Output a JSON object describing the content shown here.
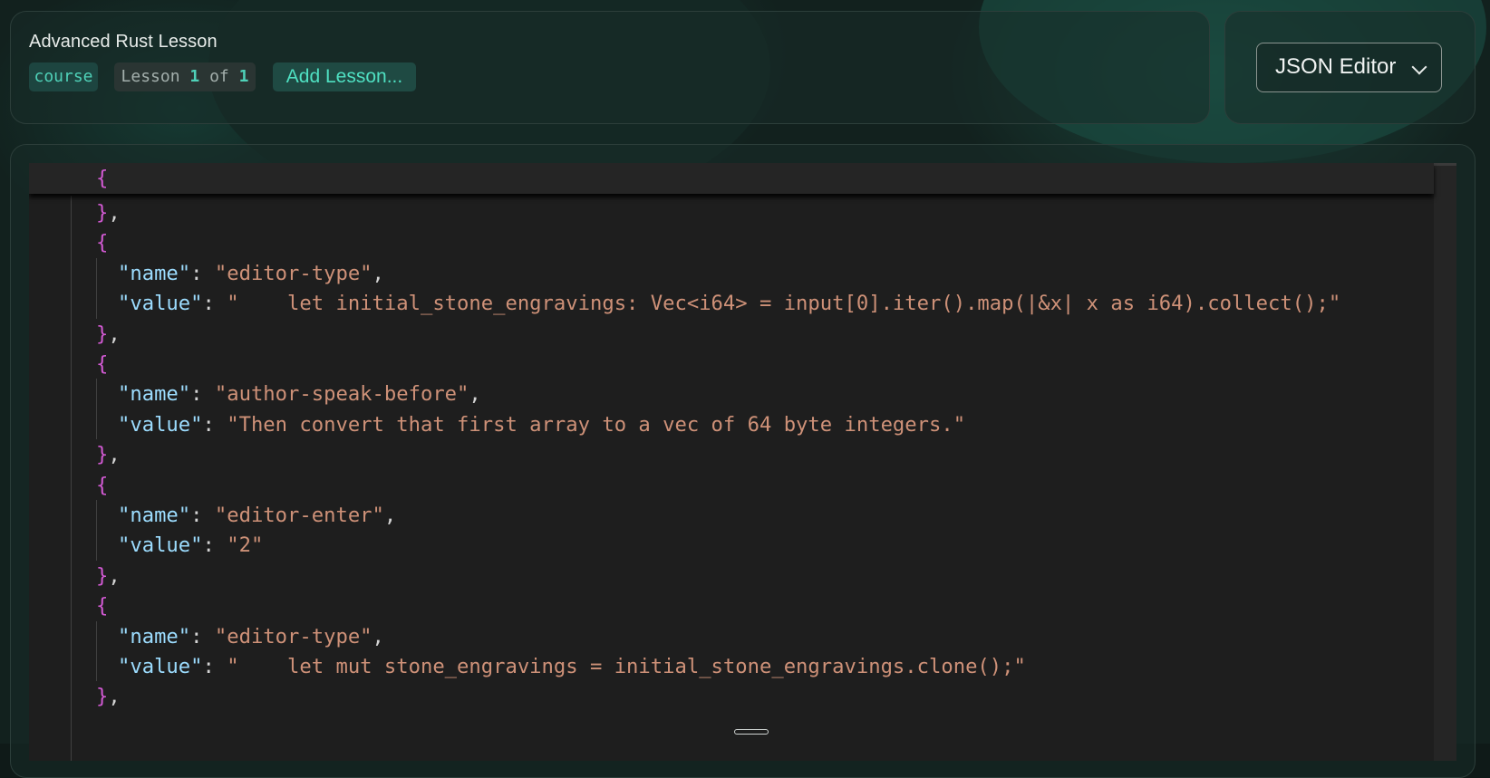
{
  "header": {
    "course_title": "Advanced Rust Lesson",
    "course_badge": "course",
    "lesson_prefix": "Lesson",
    "lesson_current": "1",
    "lesson_of": "of",
    "lesson_total": "1",
    "add_lesson_label": "Add Lesson..."
  },
  "mode_select": {
    "value": "JSON Editor"
  },
  "editor": {
    "sticky_line": "{",
    "lines": [
      {
        "type": "close"
      },
      {
        "type": "open"
      },
      {
        "type": "kv",
        "key": "\"name\"",
        "value": "\"editor-type\"",
        "comma": true
      },
      {
        "type": "kv",
        "key": "\"value\"",
        "value": "\"    let initial_stone_engravings: Vec<i64> = input[0].iter().map(|&x| x as i64).collect();\"",
        "comma": false
      },
      {
        "type": "close"
      },
      {
        "type": "open"
      },
      {
        "type": "kv",
        "key": "\"name\"",
        "value": "\"author-speak-before\"",
        "comma": true
      },
      {
        "type": "kv",
        "key": "\"value\"",
        "value": "\"Then convert that first array to a vec of 64 byte integers.\"",
        "comma": false
      },
      {
        "type": "close"
      },
      {
        "type": "open"
      },
      {
        "type": "kv",
        "key": "\"name\"",
        "value": "\"editor-enter\"",
        "comma": true
      },
      {
        "type": "kv",
        "key": "\"value\"",
        "value": "\"2\"",
        "comma": false
      },
      {
        "type": "close"
      },
      {
        "type": "open"
      },
      {
        "type": "kv",
        "key": "\"name\"",
        "value": "\"editor-type\"",
        "comma": true
      },
      {
        "type": "kv",
        "key": "\"value\"",
        "value": "\"    let mut stone_engravings = initial_stone_engravings.clone();\"",
        "comma": false
      },
      {
        "type": "close"
      }
    ]
  },
  "colors": {
    "accent": "#4fd1b8",
    "brace": "#d35ad4",
    "json_key": "#9cdcfe",
    "json_string": "#ce9178",
    "editor_bg": "#1e1e1e"
  }
}
